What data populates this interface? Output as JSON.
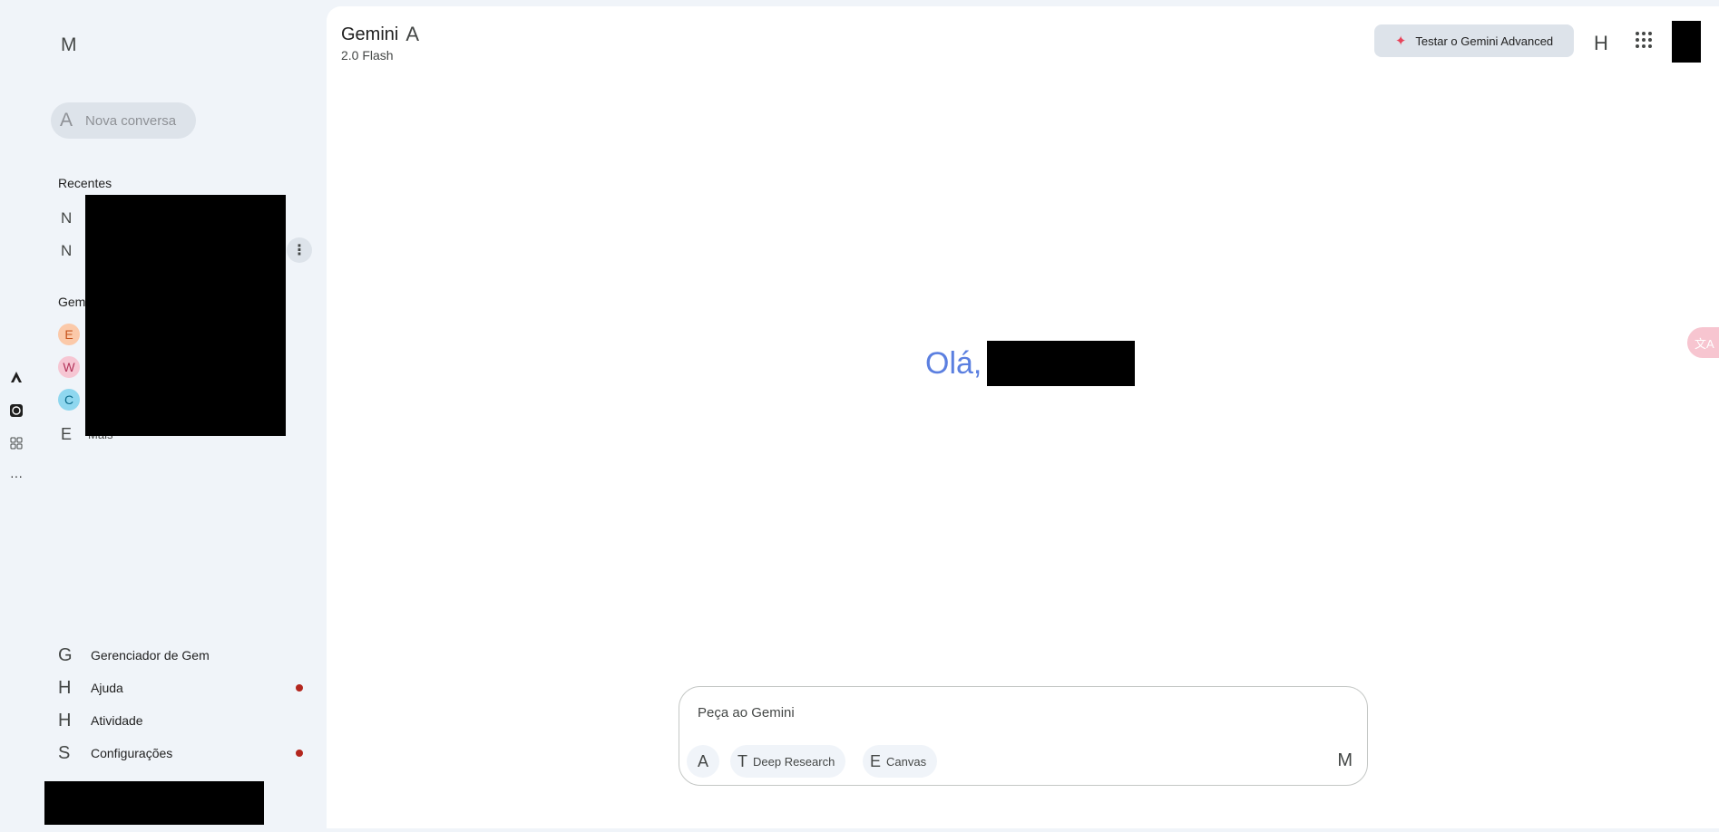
{
  "rail": {
    "icons": [
      "gemini-icon",
      "openai-icon",
      "extensions-icon",
      "more-icon"
    ],
    "more": "···"
  },
  "sidebar": {
    "menu_glyph": "M",
    "new_chat": {
      "glyph": "A",
      "label": "Nova conversa"
    },
    "recents_title": "Recentes",
    "recent_items": [
      {
        "glyph": "N"
      },
      {
        "glyph": "N"
      }
    ],
    "kebab": "⋮",
    "gems_title": "Gem",
    "gems": [
      {
        "initial": "E",
        "bg": "#fbc9a9",
        "color": "#c5541c"
      },
      {
        "initial": "W",
        "bg": "#f6c6d3",
        "color": "#b3345a"
      },
      {
        "initial": "C",
        "bg": "#8fd7ef",
        "color": "#0b6b8c"
      }
    ],
    "explore_glyph": "E",
    "explore_partial": "Mais",
    "bottom": [
      {
        "glyph": "G",
        "label": "Gerenciador de Gem",
        "dot": false
      },
      {
        "glyph": "H",
        "label": "Ajuda",
        "dot": true
      },
      {
        "glyph": "H",
        "label": "Atividade",
        "dot": false
      },
      {
        "glyph": "S",
        "label": "Configurações",
        "dot": true
      }
    ]
  },
  "header": {
    "title": "Gemini",
    "title_glyph": "A",
    "subtitle": "2.0 Flash",
    "advanced_button": "Testar o Gemini Advanced",
    "advanced_spark": "✦",
    "history_glyph": "H"
  },
  "main": {
    "greeting": "Olá,"
  },
  "composer": {
    "placeholder": "Peça ao Gemini",
    "plus_glyph": "A",
    "chips": [
      {
        "glyph": "T",
        "label": "Deep Research"
      },
      {
        "glyph": "E",
        "label": "Canvas"
      }
    ],
    "mic_glyph": "M"
  },
  "translate_fab": "文A",
  "colors": {
    "accent_greeting": "#5b7fe0",
    "notification_dot": "#b3261e",
    "spark": "#e8445a"
  }
}
